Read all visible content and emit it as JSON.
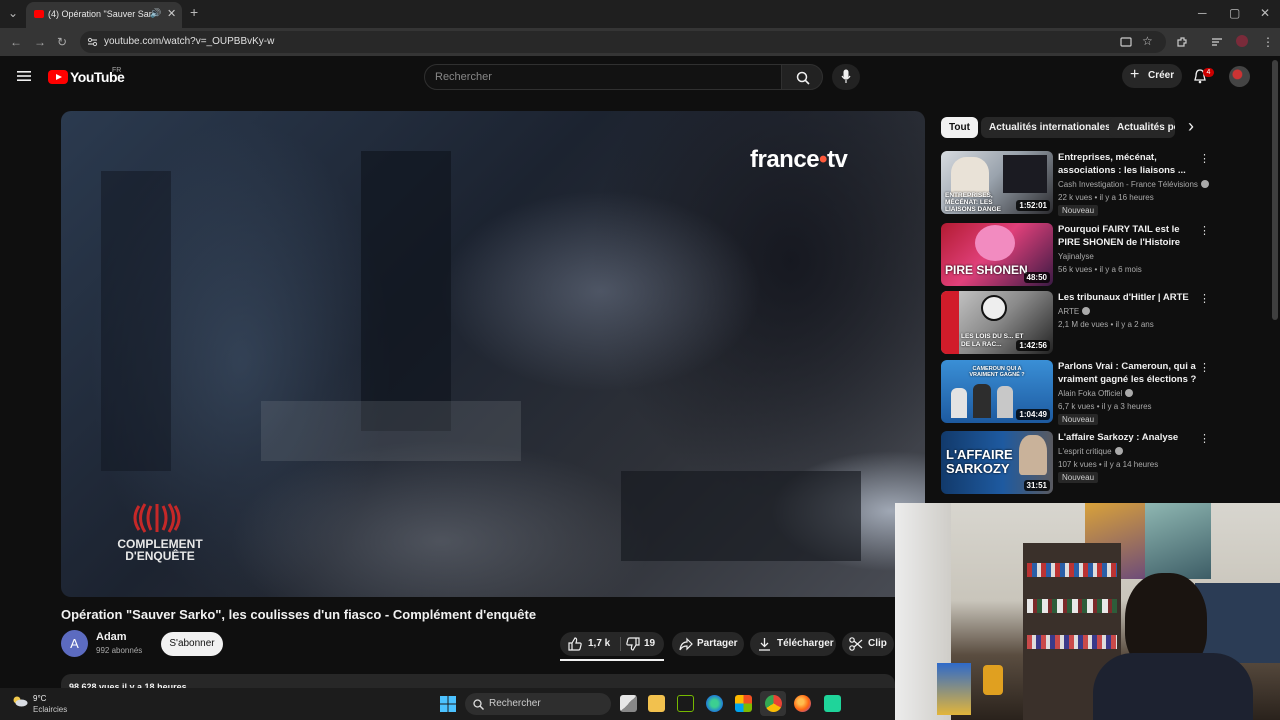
{
  "browser": {
    "tab_title": "(4) Opération \"Sauver Sarko\"",
    "url": "youtube.com/watch?v=_OUPBBvKy-w",
    "new_tab": "+",
    "tab_close": "✕",
    "tab_sound": "🔊",
    "tab_list": "⌄",
    "window_min": "─",
    "window_max": "▢",
    "window_close": "✕",
    "back_icon": "←",
    "forward_icon": "→",
    "reload_icon": "↻",
    "menu_icon": "⋮"
  },
  "youtube": {
    "logo_text": "YouTube",
    "country_code": "FR",
    "search_placeholder": "Rechercher",
    "create_label": "Créer",
    "notification_count": "4"
  },
  "video": {
    "overlay_logo_left": "france",
    "overlay_logo_dot": "•",
    "overlay_logo_right": "tv",
    "show_brand_line1": "COMPLEMENT",
    "show_brand_line2": "D'ENQUÊTE",
    "title": "Opération \"Sauver Sarko\", les coulisses d'un fiasco - Complément d'enquête",
    "channel_initial": "A",
    "channel_name": "Adam",
    "channel_subs": "992 abonnés",
    "subscribe_label": "S'abonner",
    "likes": "1,7 k",
    "dislikes": "19",
    "share_label": "Partager",
    "download_label": "Télécharger",
    "clip_label": "Clip",
    "desc_meta": "98 628 vues  il y a 18 heures"
  },
  "sidebar": {
    "chips": [
      "Tout",
      "Actualités internationales",
      "Actualités po"
    ],
    "chip_next": "›",
    "more_icon": "⋮",
    "recommendations": [
      {
        "title": "Entreprises, mécénat, associations : les liaisons ...",
        "channel": "Cash Investigation - France Télévisions",
        "verified": true,
        "views": "22 k vues",
        "age": "il y a 16 heures",
        "duration": "1:52:01",
        "badge": "Nouveau",
        "thumb_text": "ENTREPRISES, MÉCÉNAT: LES LIAISONS DANGE"
      },
      {
        "title": "Pourquoi FAIRY TAIL est le PIRE SHONEN de l'Histoire",
        "channel": "Yajinalyse",
        "verified": false,
        "views": "56 k vues",
        "age": "il y a 6 mois",
        "duration": "48:50",
        "badge": "",
        "thumb_text": "PIRE SHONEN"
      },
      {
        "title": "Les tribunaux d'Hitler | ARTE",
        "channel": "ARTE",
        "verified": true,
        "views": "2,1 M de vues",
        "age": "il y a 2 ans",
        "duration": "1:42:56",
        "badge": "",
        "thumb_text": "LES LOIS DU S... ET DE LA RAC..."
      },
      {
        "title": "Parlons Vrai : Cameroun, qui a vraiment gagné les élections ?",
        "channel": "Alain Foka Officiel",
        "verified": true,
        "views": "6,7 k vues",
        "age": "il y a 3 heures",
        "duration": "1:04:49",
        "badge": "Nouveau",
        "thumb_text": "CAMEROUN QUI A VRAIMENT GAGNÉ ?"
      },
      {
        "title": "L'affaire Sarkozy : Analyse",
        "channel": "L'esprit critique",
        "verified": true,
        "views": "107 k vues",
        "age": "il y a 14 heures",
        "duration": "31:51",
        "badge": "Nouveau",
        "thumb_text": "L'AFFAIRE SARKOZY"
      }
    ]
  },
  "taskbar": {
    "temperature": "9°C",
    "weather": "Eclaircies",
    "search_label": "Rechercher"
  }
}
